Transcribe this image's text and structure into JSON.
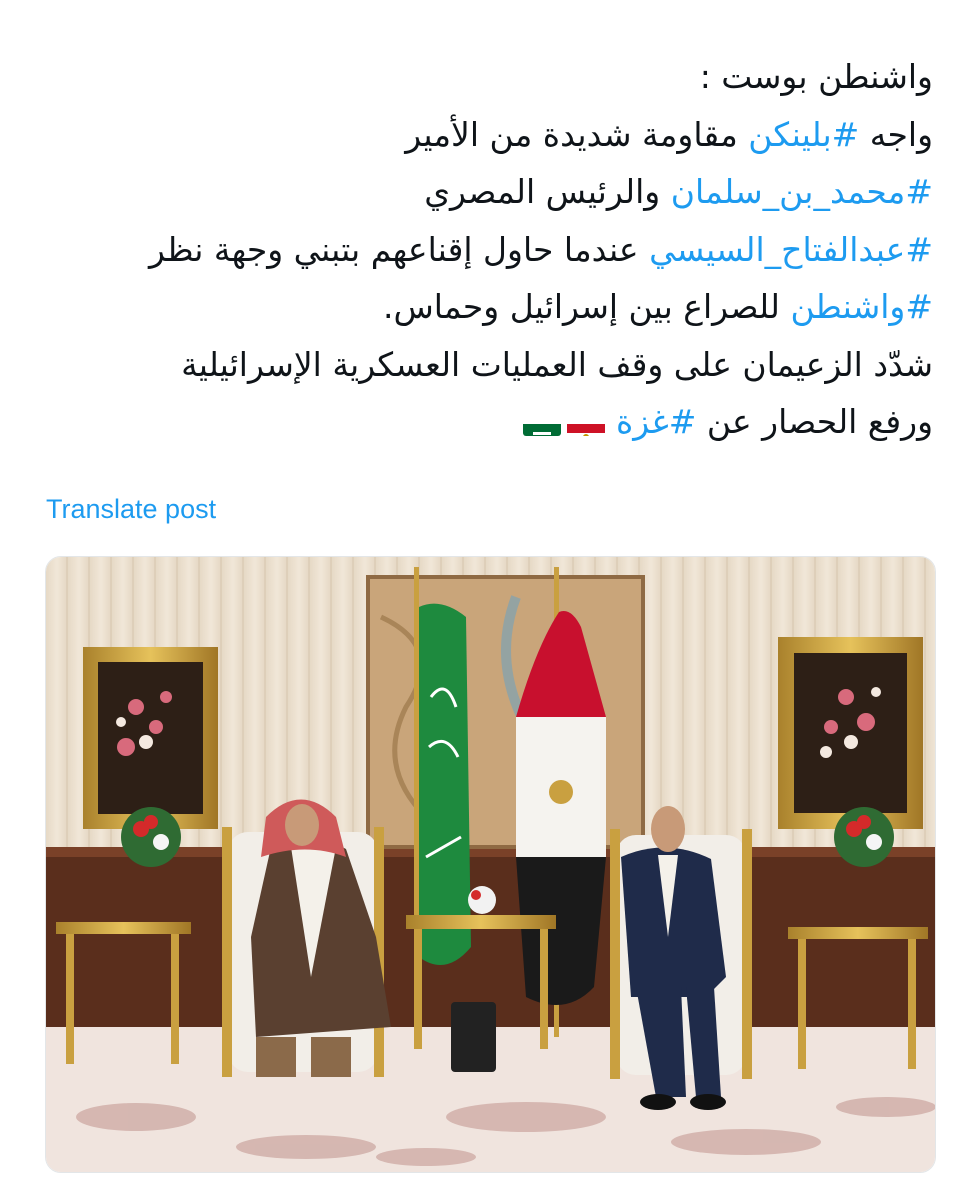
{
  "post": {
    "lines": [
      [
        {
          "t": "واشنطن بوست :",
          "tag": false
        }
      ],
      [
        {
          "t": "واجه ",
          "tag": false
        },
        {
          "t": "#بلينكن",
          "tag": true
        },
        {
          "t": " مقاومة شديدة من الأمير",
          "tag": false
        }
      ],
      [
        {
          "t": "#محمد_بن_سلمان",
          "tag": true
        },
        {
          "t": " والرئيس المصري",
          "tag": false
        }
      ],
      [
        {
          "t": "#عبدالفتاح_السيسي",
          "tag": true
        },
        {
          "t": " عندما حاول إقناعهم بتبني وجهة نظر",
          "tag": false
        }
      ],
      [
        {
          "t": "#واشنطن",
          "tag": true
        },
        {
          "t": " للصراع بين إسرائيل وحماس.",
          "tag": false
        }
      ],
      [
        {
          "t": "شدّد الزعيمان على وقف العمليات العسكرية الإسرائيلية",
          "tag": false
        }
      ],
      [
        {
          "t": "ورفع الحصار عن ",
          "tag": false
        },
        {
          "t": "#غزة",
          "tag": true
        }
      ]
    ],
    "flags": [
      "egypt-flag-icon",
      "saudi-flag-icon"
    ]
  },
  "translate_label": "Translate post",
  "media": {
    "description_icon": "meeting-photo",
    "colors": {
      "link": "#1d9bf0",
      "text": "#0f1419",
      "carpet": "#efe2dc",
      "saudi_green": "#1e8a3e",
      "egypt_red": "#c8102e"
    }
  }
}
